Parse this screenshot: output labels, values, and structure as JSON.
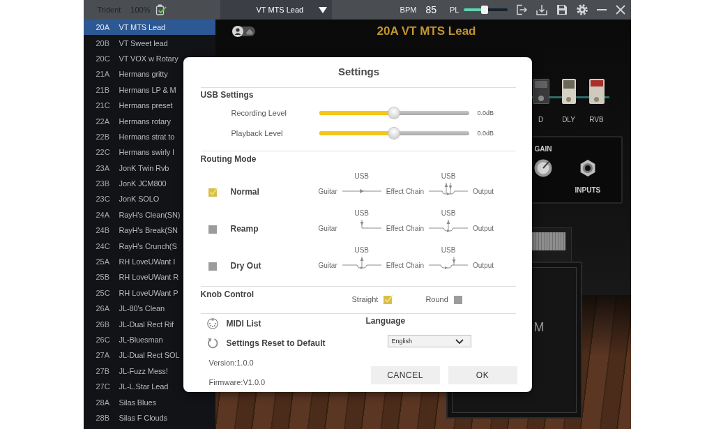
{
  "top_bar": {
    "device": "Trident",
    "battery": "100%",
    "preset": "VT MTS Lead",
    "bpm_label": "BPM",
    "bpm": "85",
    "pl": {
      "label": "PL",
      "level": 0.48
    }
  },
  "presets": [
    {
      "code": "20A",
      "name": "VT MTS Lead",
      "selected": true
    },
    {
      "code": "20B",
      "name": "VT Sweet lead",
      "selected": false
    },
    {
      "code": "20C",
      "name": "VT VOX w Rotary",
      "selected": false
    },
    {
      "code": "21A",
      "name": "Hermans gritty",
      "selected": false
    },
    {
      "code": "21B",
      "name": "Hermans LP & M",
      "selected": false
    },
    {
      "code": "21C",
      "name": "Hermans preset",
      "selected": false
    },
    {
      "code": "22A",
      "name": "Hermans rotary",
      "selected": false
    },
    {
      "code": "22B",
      "name": "Hermans strat to",
      "selected": false
    },
    {
      "code": "22C",
      "name": "Hermans swirly l",
      "selected": false
    },
    {
      "code": "23A",
      "name": "JonK Twin Rvb",
      "selected": false
    },
    {
      "code": "23B",
      "name": "JonK JCM800",
      "selected": false
    },
    {
      "code": "23C",
      "name": "JonK SOLO",
      "selected": false
    },
    {
      "code": "24A",
      "name": "RayH's Clean(SN)",
      "selected": false
    },
    {
      "code": "24B",
      "name": "RayH's Break(SN",
      "selected": false
    },
    {
      "code": "24C",
      "name": "RayH's Crunch(S",
      "selected": false
    },
    {
      "code": "25A",
      "name": "RH LoveUWant I",
      "selected": false
    },
    {
      "code": "25B",
      "name": "RH LoveUWant R",
      "selected": false
    },
    {
      "code": "25C",
      "name": "RH LoveUWant P",
      "selected": false
    },
    {
      "code": "26A",
      "name": "JL-80's Clean",
      "selected": false
    },
    {
      "code": "26B",
      "name": "JL-Dual Rect Rif",
      "selected": false
    },
    {
      "code": "26C",
      "name": "JL-Bluesman",
      "selected": false
    },
    {
      "code": "27A",
      "name": "JL-Dual Rect SOL",
      "selected": false
    },
    {
      "code": "27B",
      "name": "JL-Fuzz Mess!",
      "selected": false
    },
    {
      "code": "27C",
      "name": "JL-L.Star Lead",
      "selected": false
    },
    {
      "code": "28A",
      "name": "Silas Blues",
      "selected": false
    },
    {
      "code": "28B",
      "name": "Silas F Clouds",
      "selected": false
    }
  ],
  "stage": {
    "title": "20A VT MTS Lead",
    "pedals": [
      {
        "label": "D",
        "kind": "drive"
      },
      {
        "label": "DLY",
        "kind": "delay"
      },
      {
        "label": "RVB",
        "kind": "reverb"
      }
    ],
    "amp": {
      "gain_label": "GAIN",
      "inputs_label": "INPUTS"
    },
    "cabinet": {
      "logo": "M"
    }
  },
  "settings": {
    "title": "Settings",
    "usb": {
      "heading": "USB Settings",
      "sliders": [
        {
          "label": "Recording Level",
          "level": 0.5,
          "reading": "0.0dB"
        },
        {
          "label": "Playback Level",
          "level": 0.5,
          "reading": "0.0dB"
        }
      ]
    },
    "routing": {
      "heading": "Routing Mode",
      "modes": [
        {
          "label": "Normal",
          "selected": true,
          "nodes": [
            "Guitar",
            "Effect Chain",
            "Output"
          ],
          "links": [
            {
              "tag": "USB",
              "kind": "pass"
            },
            {
              "tag": "USB",
              "kind": "both"
            }
          ]
        },
        {
          "label": "Reamp",
          "selected": false,
          "nodes": [
            "Guitar",
            "Effect Chain",
            "Output"
          ],
          "links": [
            {
              "tag": "USB",
              "kind": "in"
            },
            {
              "tag": "USB",
              "kind": "out"
            }
          ]
        },
        {
          "label": "Dry Out",
          "selected": false,
          "nodes": [
            "Guitar",
            "Effect Chain",
            "Output"
          ],
          "links": [
            {
              "tag": "USB",
              "kind": "out"
            },
            {
              "tag": "USB",
              "kind": "join"
            }
          ]
        }
      ]
    },
    "knob": {
      "heading": "Knob Control",
      "options": [
        {
          "label": "Straight",
          "selected": true
        },
        {
          "label": "Round",
          "selected": false
        }
      ]
    },
    "midi_list": "MIDI List",
    "reset": "Settings Reset to Default",
    "language": {
      "label": "Language",
      "value": "English"
    },
    "version": "Version:1.0.0",
    "firmware": "Firmware:V1.0.0",
    "buttons": [
      "CANCEL",
      "OK"
    ]
  }
}
